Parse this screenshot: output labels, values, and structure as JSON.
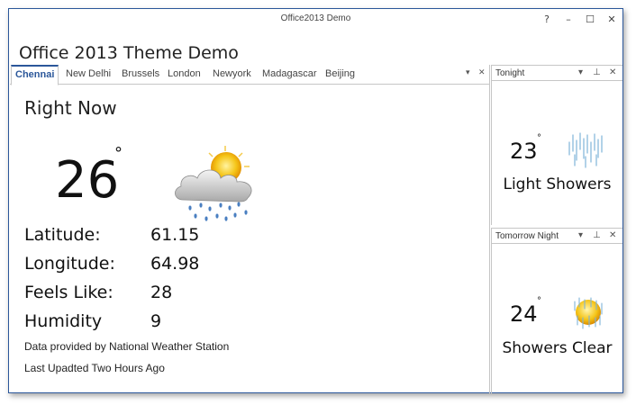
{
  "window": {
    "title": "Office2013 Demo",
    "buttons": {
      "help": "?",
      "minimize": "–",
      "maximize": "☐",
      "close": "✕"
    }
  },
  "app_title": "Office 2013 Theme Demo",
  "tabs": [
    "Chennai",
    "New Delhi",
    "Brussels",
    "London",
    "Newyork",
    "Madagascar",
    "Beijing"
  ],
  "tab_controls": {
    "dropdown": "▾",
    "close": "✕"
  },
  "main": {
    "section_title": "Right Now",
    "temperature": "26",
    "degree": "°",
    "icon": "partly-cloudy-rain-icon",
    "details": [
      {
        "label": "Latitude:",
        "value": "61.15"
      },
      {
        "label": "Longitude:",
        "value": "64.98"
      },
      {
        "label": "Feels Like:",
        "value": "28"
      },
      {
        "label": "Humidity",
        "value": "9"
      }
    ],
    "source": "Data provided by National Weather Station",
    "updated": "Last Upadted Two Hours Ago"
  },
  "panels": [
    {
      "title": "Tonight",
      "temperature": "23",
      "degree": "°",
      "condition": "Light Showers",
      "icon": "light-showers-icon"
    },
    {
      "title": "Tomorrow Night",
      "temperature": "24",
      "degree": "°",
      "condition": "Showers Clear",
      "icon": "showers-clear-icon"
    }
  ],
  "panel_controls": {
    "dropdown": "▾",
    "pin": "⊥",
    "close": "✕"
  },
  "colors": {
    "accent": "#2b579a",
    "border": "#c6c6c6",
    "sun": "#f5c518",
    "rain": "#4a7fc1"
  }
}
